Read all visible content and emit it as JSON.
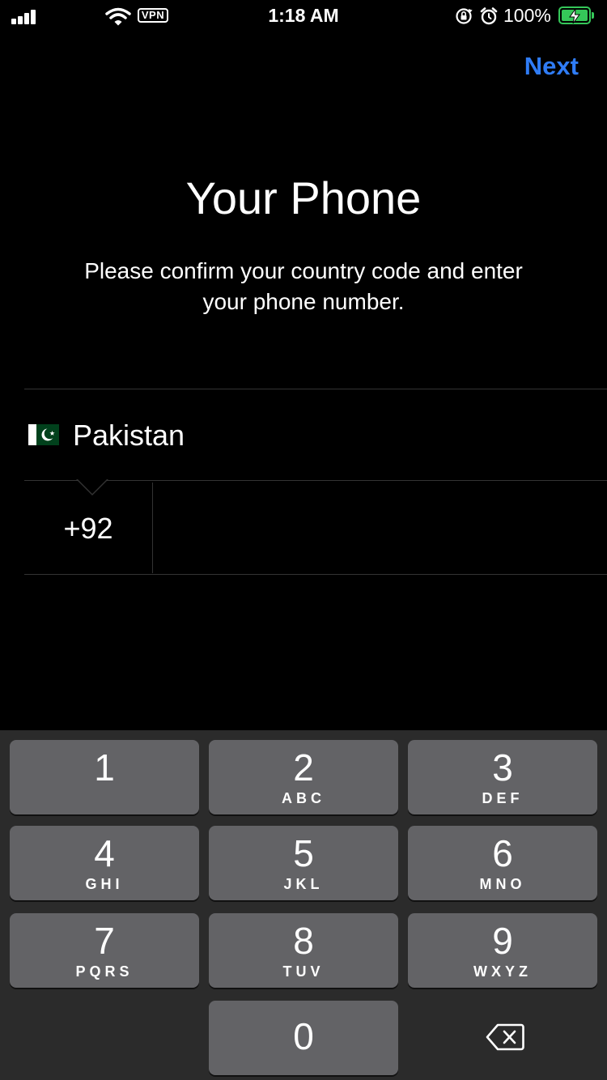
{
  "status_bar": {
    "time": "1:18 AM",
    "vpn": "VPN",
    "battery": "100%",
    "icons": [
      "signal-icon",
      "wifi-icon",
      "vpn-icon",
      "orientation-lock-icon",
      "alarm-icon",
      "battery-charging-icon"
    ]
  },
  "header": {
    "next_label": "Next"
  },
  "content": {
    "title": "Your Phone",
    "subtitle": "Please confirm your country code and enter your phone number."
  },
  "country": {
    "flag_icon": "pakistan-flag-icon",
    "name": "Pakistan",
    "code": "+92",
    "phone_number": ""
  },
  "keypad": {
    "keys": [
      {
        "digit": "1",
        "letters": ""
      },
      {
        "digit": "2",
        "letters": "ABC"
      },
      {
        "digit": "3",
        "letters": "DEF"
      },
      {
        "digit": "4",
        "letters": "GHI"
      },
      {
        "digit": "5",
        "letters": "JKL"
      },
      {
        "digit": "6",
        "letters": "MNO"
      },
      {
        "digit": "7",
        "letters": "PQRS"
      },
      {
        "digit": "8",
        "letters": "TUV"
      },
      {
        "digit": "9",
        "letters": "WXYZ"
      },
      {
        "digit": "0",
        "letters": ""
      }
    ],
    "backspace_icon": "backspace-icon"
  },
  "colors": {
    "background": "#000000",
    "accent": "#2f7cf6",
    "battery_green": "#35c759",
    "keyboard_bg": "#2b2b2b",
    "key_bg": "#636366",
    "divider": "#333333"
  }
}
